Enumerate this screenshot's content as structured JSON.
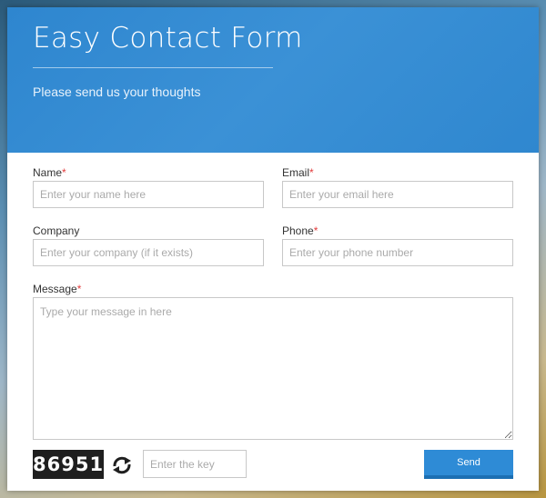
{
  "header": {
    "title": "Easy Contact Form",
    "subtitle": "Please send us your thoughts"
  },
  "form": {
    "name": {
      "label": "Name",
      "required_mark": "*",
      "placeholder": "Enter your name here"
    },
    "email": {
      "label": "Email",
      "required_mark": "*",
      "placeholder": "Enter your email here"
    },
    "company": {
      "label": "Company",
      "placeholder": "Enter your company (if it exists)"
    },
    "phone": {
      "label": "Phone",
      "required_mark": "*",
      "placeholder": "Enter your phone number"
    },
    "message": {
      "label": "Message",
      "required_mark": "*",
      "placeholder": "Type your message in here"
    },
    "captcha": {
      "code": "86951",
      "placeholder": "Enter the key",
      "refresh_icon": "refresh-icon"
    },
    "send_label": "Send"
  },
  "colors": {
    "accent": "#2e8bd6",
    "required": "#e23c3c"
  }
}
